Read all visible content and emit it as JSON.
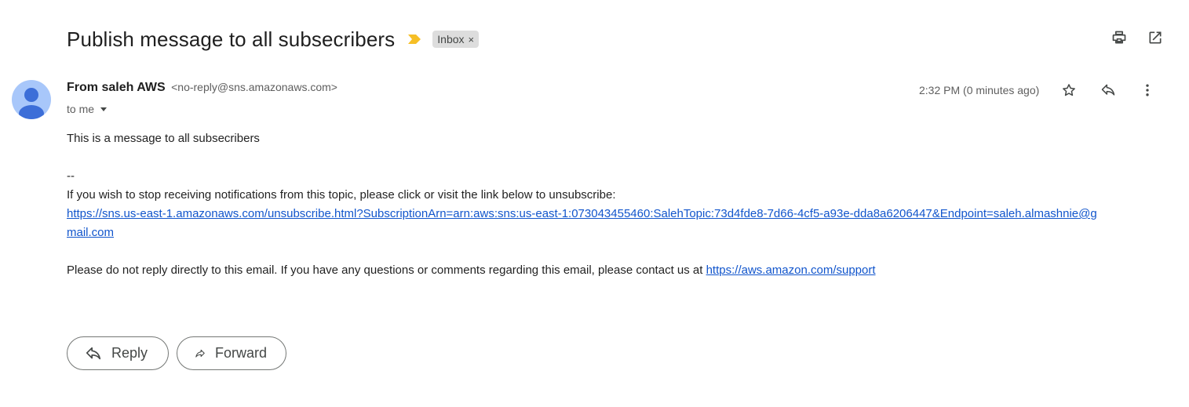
{
  "email": {
    "subject": "Publish message to all subsecribers",
    "label_chip": "Inbox",
    "label_chip_remove": "×",
    "sender_name": "From saleh AWS",
    "sender_email": "<no-reply@sns.amazonaws.com>",
    "recipient": "to me",
    "timestamp": "2:32 PM (0 minutes ago)",
    "body": {
      "line1": "This is a message to all subsecribers",
      "separator": "--",
      "unsubscribe_text": "If you wish to stop receiving notifications from this topic, please click or visit the link below to unsubscribe:",
      "unsubscribe_link": "https://sns.us-east-1.amazonaws.com/unsubscribe.html?SubscriptionArn=arn:aws:sns:us-east-1:073043455460:SalehTopic:73d4fde8-7d66-4cf5-a93e-dda8a6206447&Endpoint=saleh.almashnie@gmail.com",
      "support_text": "Please do not reply directly to this email. If you have any questions or comments regarding this email, please contact us at ",
      "support_link": "https://aws.amazon.com/support"
    }
  },
  "actions": {
    "reply_label": "Reply",
    "forward_label": "Forward"
  },
  "icons": {
    "importance": "importance-marker-icon",
    "print": "print-icon",
    "open_new_window": "open-in-new-window-icon",
    "star": "star-icon",
    "reply": "reply-icon",
    "more": "more-vertical-icon",
    "forward": "forward-icon",
    "avatar": "default-avatar-icon"
  },
  "colors": {
    "importance": "#f6bf26",
    "avatar_bg": "#a8c7fa",
    "avatar_fg": "#3c6ed8",
    "link": "#1155cc"
  }
}
